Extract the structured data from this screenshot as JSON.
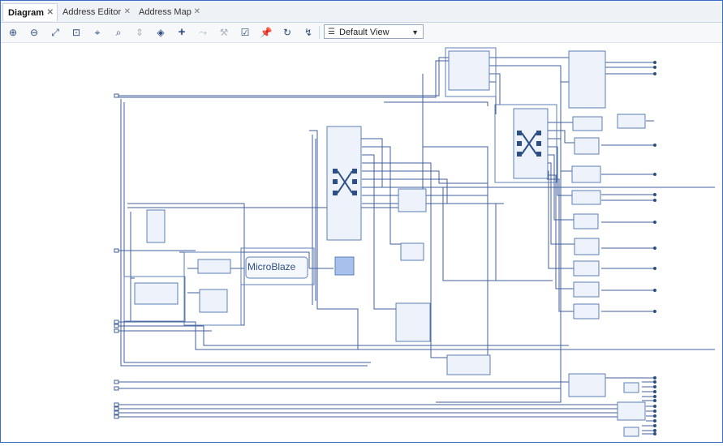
{
  "tabs": [
    {
      "label": "Diagram",
      "active": true
    },
    {
      "label": "Address Editor",
      "active": false
    },
    {
      "label": "Address Map",
      "active": false
    }
  ],
  "toolbar": {
    "buttons": [
      "zoom-in",
      "zoom-out",
      "zoom-fit",
      "zoom-area",
      "center",
      "search",
      "collapse",
      "expand",
      "add-ip",
      "connect",
      "validate",
      "properties",
      "pin",
      "refresh",
      "optimize"
    ],
    "view_select": "Default View"
  },
  "diagram": {
    "microblaze_label": "MicroBlaze",
    "accent_color": "#3f5f9b",
    "block_fill": "#eef3fb",
    "block_border": "#5b7fb6"
  }
}
